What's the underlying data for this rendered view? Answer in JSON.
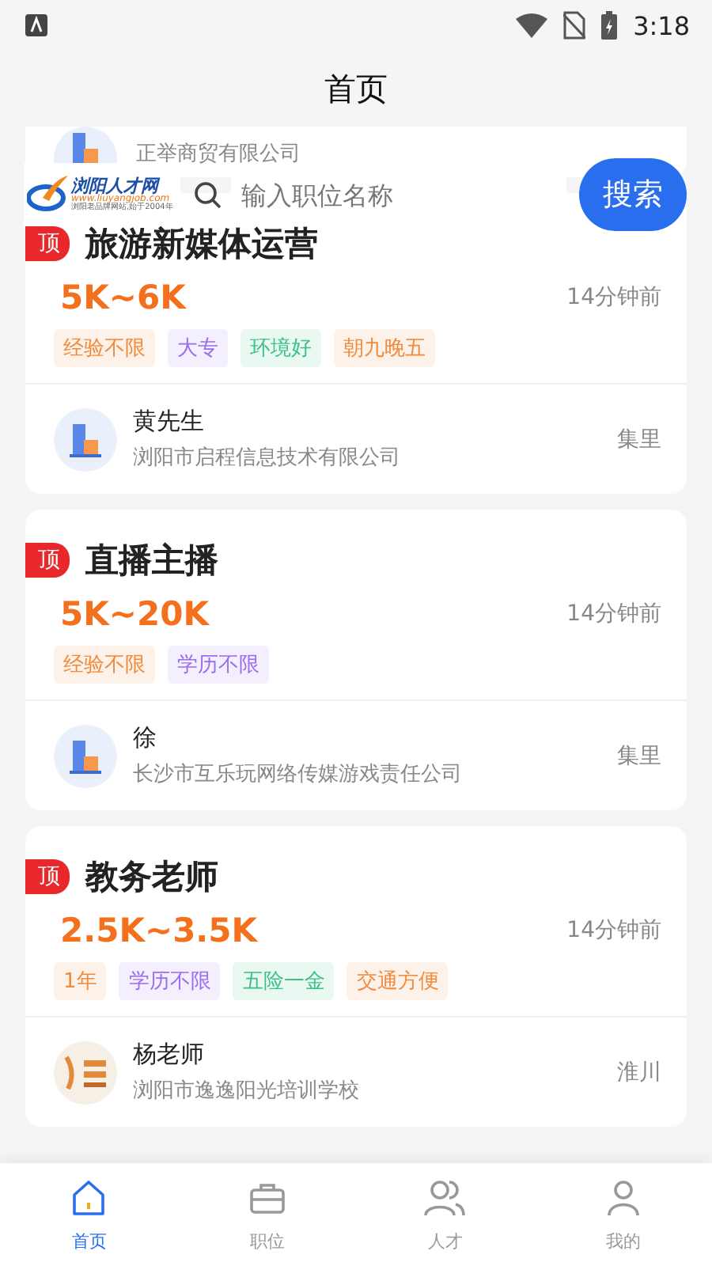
{
  "status_bar": {
    "time": "3:18"
  },
  "header": {
    "title": "首页"
  },
  "search": {
    "logo_title": "浏阳人才网",
    "logo_url": "www.liuyangjob.com",
    "logo_slogan": "浏阳老品牌网站,始于2004年",
    "placeholder": "输入职位名称",
    "button": "搜索"
  },
  "jobs": [
    {
      "kind": "partial",
      "company": "正举商贸有限公司"
    },
    {
      "kind": "building",
      "badge": "顶",
      "title": "旅游新媒体运营",
      "salary": "5K~6K",
      "time": "14分钟前",
      "tags": [
        {
          "text": "经验不限",
          "color": "#f08a3c"
        },
        {
          "text": "大专",
          "color": "#9b6cf0"
        },
        {
          "text": "环境好",
          "color": "#3cbf8a"
        },
        {
          "text": "朝九晚五",
          "color": "#f08a3c"
        }
      ],
      "contact": "黄先生",
      "company": "浏阳市启程信息技术有限公司",
      "location": "集里"
    },
    {
      "kind": "building",
      "badge": "顶",
      "title": "直播主播",
      "salary": "5K~20K",
      "time": "14分钟前",
      "tags": [
        {
          "text": "经验不限",
          "color": "#f08a3c"
        },
        {
          "text": "学历不限",
          "color": "#9b6cf0"
        }
      ],
      "contact": "徐",
      "company": "长沙市互乐玩网络传媒游戏责任公司",
      "location": "集里"
    },
    {
      "kind": "school",
      "badge": "顶",
      "title": "教务老师",
      "salary": "2.5K~3.5K",
      "time": "14分钟前",
      "tags": [
        {
          "text": "1年",
          "color": "#f08a3c"
        },
        {
          "text": "学历不限",
          "color": "#9b6cf0"
        },
        {
          "text": "五险一金",
          "color": "#3cbf8a"
        },
        {
          "text": "交通方便",
          "color": "#f08a3c"
        }
      ],
      "contact": "杨老师",
      "company": "浏阳市逸逸阳光培训学校",
      "location": "淮川"
    }
  ],
  "nav": [
    {
      "label": "首页",
      "selected": true
    },
    {
      "label": "职位",
      "selected": false
    },
    {
      "label": "人才",
      "selected": false
    },
    {
      "label": "我的",
      "selected": false
    }
  ]
}
